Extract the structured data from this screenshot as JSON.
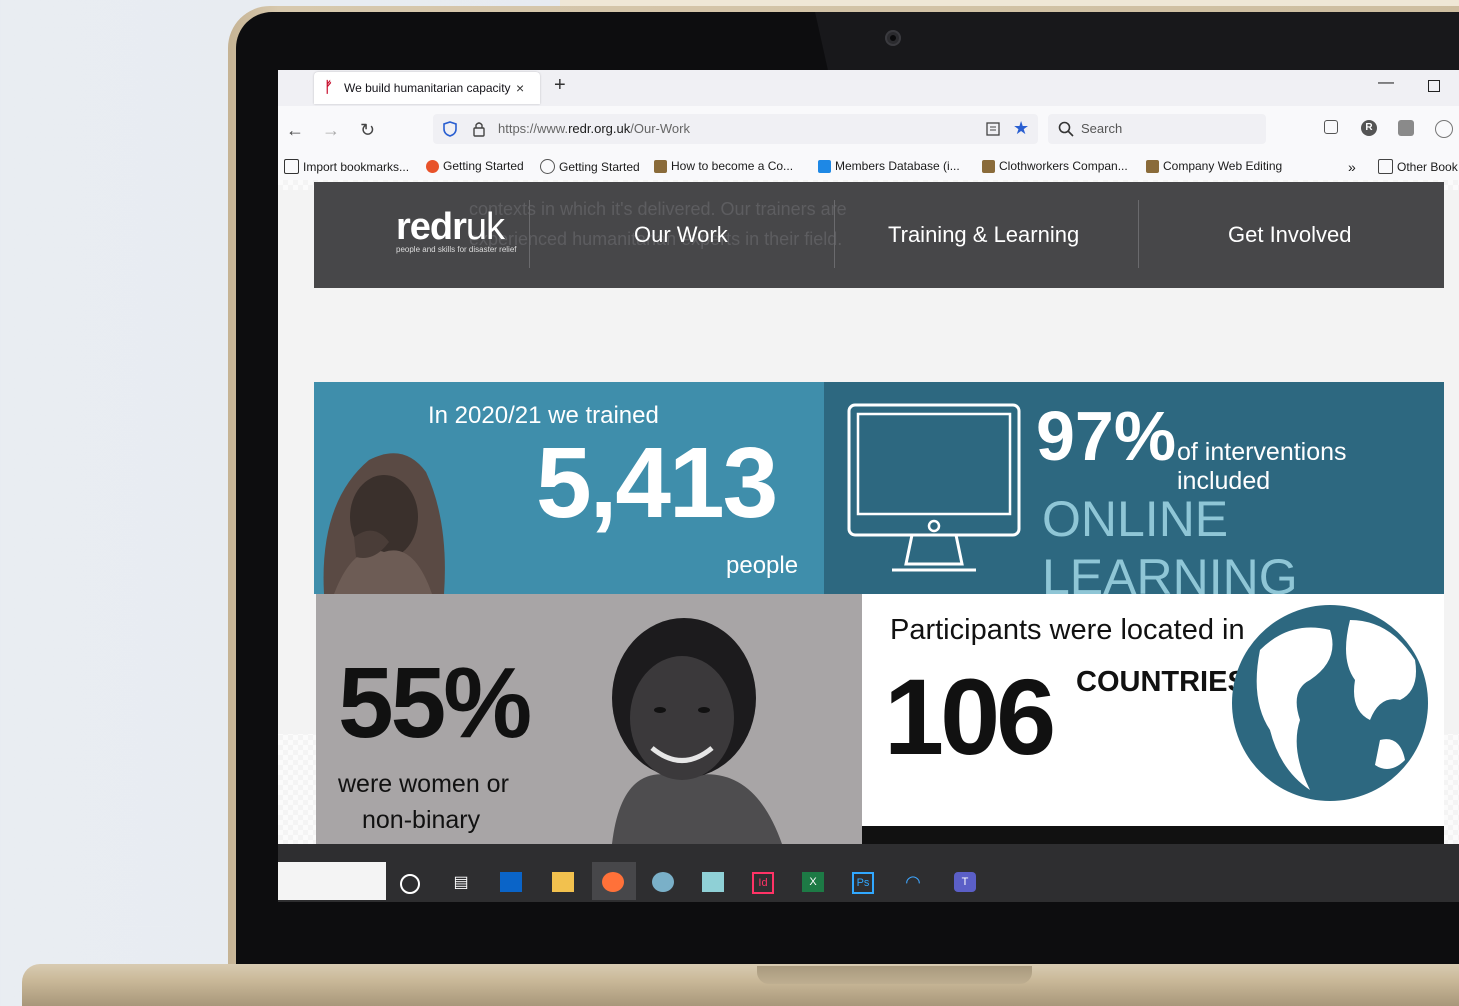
{
  "browser": {
    "tab_title": "We build humanitarian capacity",
    "tab_close": "×",
    "new_tab": "+",
    "url_prefix": "https://www.",
    "url_domain": "redr.org.uk",
    "url_path": "/Our-Work",
    "search_placeholder": "Search"
  },
  "bookmarks": [
    {
      "label": "Import bookmarks...",
      "icon": "import-icon"
    },
    {
      "label": "Getting Started",
      "icon": "firefox-icon"
    },
    {
      "label": "Getting Started",
      "icon": "globe-icon"
    },
    {
      "label": "How to become a Co...",
      "icon": "crest-icon"
    },
    {
      "label": "Members Database (i...",
      "icon": "info-icon"
    },
    {
      "label": "Clothworkers Compan...",
      "icon": "crest-icon"
    },
    {
      "label": "Company Web Editing",
      "icon": "crest-icon"
    },
    {
      "label": "Other Book",
      "icon": "folder-icon"
    }
  ],
  "site": {
    "ghost_line1": "contexts in which it's delivered. Our trainers are",
    "ghost_line2": "experienced humanitarian experts in their field.",
    "logo_text_bold": "redr",
    "logo_text_light": "uk",
    "logo_tagline": "people and skills for disaster relief",
    "nav": [
      "Our Work",
      "Training & Learning",
      "Get Involved"
    ]
  },
  "stats": {
    "trained_intro": "In 2020/21 we trained",
    "trained_count": "5,413",
    "trained_unit": "people",
    "online_pct": "97%",
    "online_text": "of interventions included",
    "online_caption": "ONLINE LEARNING",
    "women_pct": "55%",
    "women_line1": "were women or",
    "women_line2": "non-binary",
    "countries_intro": "Participants were located in",
    "countries_count": "106",
    "countries_label": "COUNTRIES"
  },
  "colors": {
    "teal_light": "#3f8eab",
    "teal_dark": "#2d6880",
    "header_gray": "#474749",
    "caption_teal": "#8fc6d6"
  }
}
